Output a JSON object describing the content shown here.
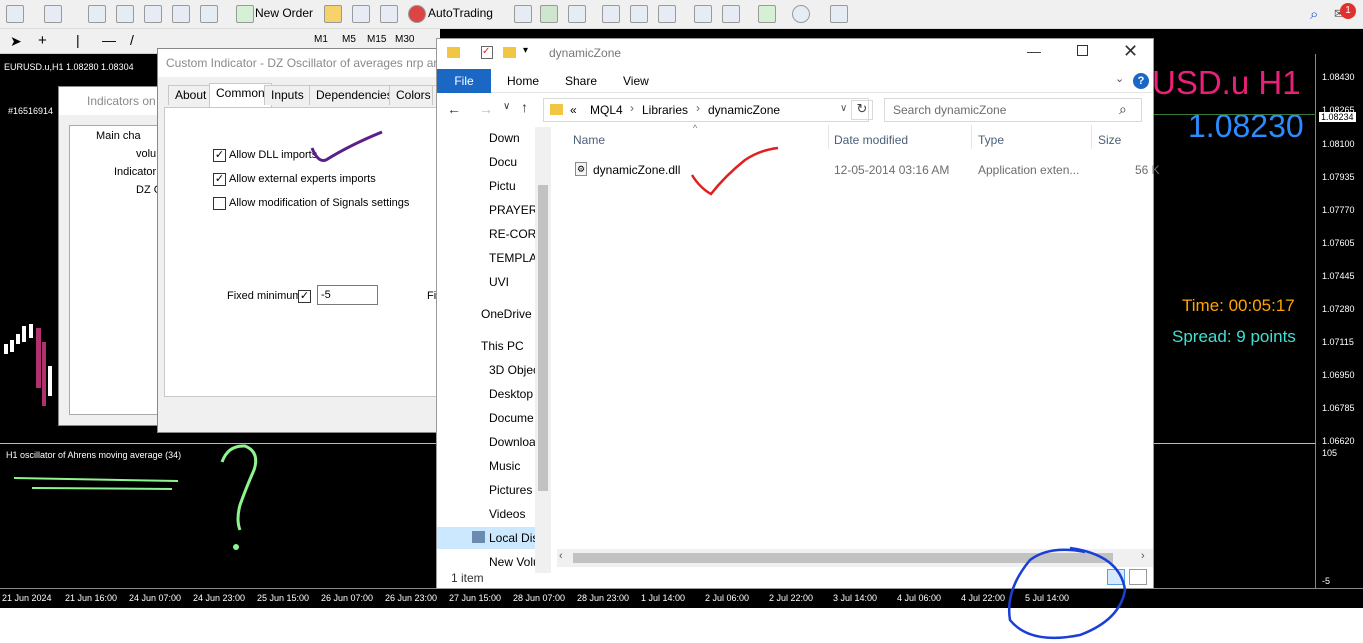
{
  "toolbar": {
    "new_order": "New Order",
    "autotrading": "AutoTrading",
    "notif_count": "1",
    "timeframes": [
      "M1",
      "M5",
      "M15",
      "M30"
    ]
  },
  "chart": {
    "symbol_header": "EURUSD.u,H1  1.08280 1.08304",
    "order_id": "#16516914",
    "big_symbol": "USD.u H1",
    "big_price": "1.08230",
    "time_text": "Time: 00:05:17",
    "spread_text": "Spread: 9 points",
    "osc_label": "H1 oscillator of Ahrens moving average (34)",
    "price_labels": [
      "1.08430",
      "1.08265",
      "1.08234",
      "1.08100",
      "1.07935",
      "1.07770",
      "1.07605",
      "1.07445",
      "1.07280",
      "1.07115",
      "1.06950",
      "1.06785",
      "1.06620",
      "105",
      "-5"
    ],
    "time_labels": [
      "21 Jun 2024",
      "21 Jun 16:00",
      "24 Jun 07:00",
      "24 Jun 23:00",
      "25 Jun 15:00",
      "26 Jun 07:00",
      "26 Jun 23:00",
      "27 Jun 15:00",
      "28 Jun 07:00",
      "28 Jun 23:00",
      "1 Jul 14:00",
      "2 Jul 06:00",
      "2 Jul 22:00",
      "3 Jul 14:00",
      "4 Jul 06:00",
      "4 Jul 22:00",
      "5 Jul 14:00"
    ]
  },
  "indicators_dialog": {
    "title": "Indicators on",
    "tree": [
      "Main cha",
      "volu",
      "Indicator",
      "DZ O"
    ]
  },
  "custom_dialog": {
    "title": "Custom Indicator - DZ Oscillator of averages nrp ar",
    "tabs": [
      "About",
      "Common",
      "Inputs",
      "Dependencies",
      "Colors",
      "L"
    ],
    "active_tab": "Common",
    "options": [
      {
        "label": "Allow DLL imports",
        "checked": true
      },
      {
        "label": "Allow external experts imports",
        "checked": true
      },
      {
        "label": "Allow modification of Signals settings",
        "checked": false
      }
    ],
    "fixed_min_label": "Fixed minimum",
    "fixed_min_value": "-5",
    "fixed_max_stub": "Fix"
  },
  "explorer": {
    "title": "dynamicZone",
    "ribbon": [
      "File",
      "Home",
      "Share",
      "View"
    ],
    "path": [
      "«",
      "MQL4",
      "Libraries",
      "dynamicZone"
    ],
    "search_placeholder": "Search dynamicZone",
    "columns": [
      "Name",
      "Date modified",
      "Type",
      "Size"
    ],
    "files": [
      {
        "name": "dynamicZone.dll",
        "date": "12-05-2014 03:16 AM",
        "type": "Application exten...",
        "size": "56 K"
      }
    ],
    "nav": [
      "Down",
      "Docu",
      "Pictu",
      "PRAYER",
      "RE-CORR",
      "TEMPLAT",
      "UVI",
      "OneDrive",
      "This PC",
      "3D Objec",
      "Desktop",
      "Docume",
      "Downloa",
      "Music",
      "Pictures",
      "Videos",
      "Local Dis",
      "New Volu"
    ],
    "status": "1 item"
  },
  "colors": {
    "big_symbol": "#e8207a",
    "big_price": "#2a8cff",
    "time": "#ffa500",
    "spread": "#40e0d0",
    "annot_check": "#5a1f8a",
    "annot_red": "#e02020",
    "annot_green": "#8ef58e",
    "annot_blue": "#1a3fd6"
  }
}
